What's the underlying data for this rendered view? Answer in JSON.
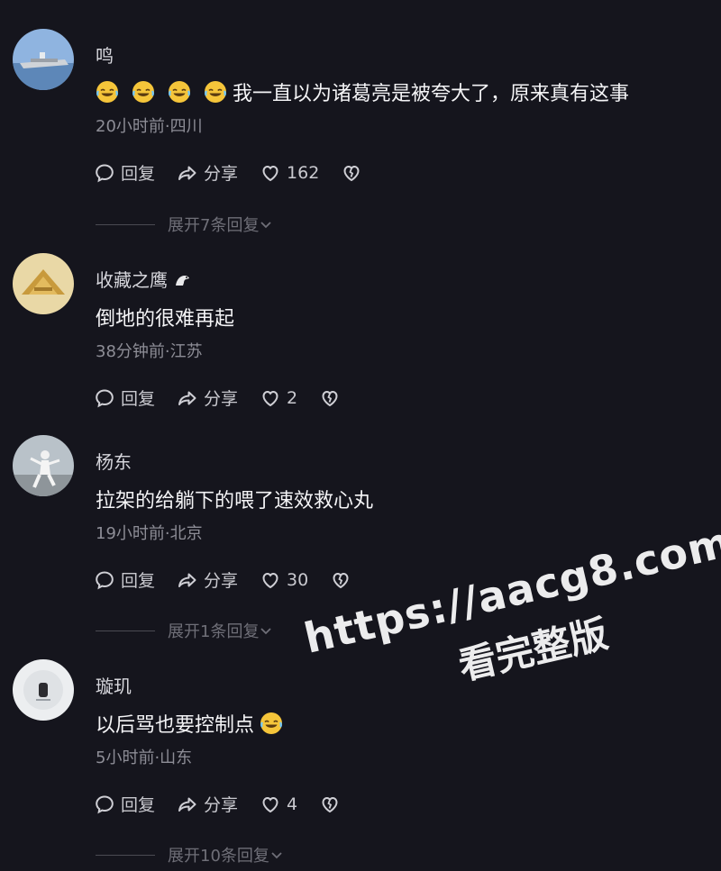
{
  "comments": [
    {
      "username": "鸣",
      "text": "我一直以为诸葛亮是被夸大了，原来真有这事",
      "meta": "20小时前·四川",
      "reply_label": "回复",
      "share_label": "分享",
      "likes": "162",
      "expand_label": "展开7条回复"
    },
    {
      "username": "收藏之鹰",
      "text": "倒地的很难再起",
      "meta": "38分钟前·江苏",
      "reply_label": "回复",
      "share_label": "分享",
      "likes": "2"
    },
    {
      "username": "杨东",
      "text": "拉架的给躺下的喂了速效救心丸",
      "meta": "19小时前·北京",
      "reply_label": "回复",
      "share_label": "分享",
      "likes": "30",
      "expand_label": "展开1条回复"
    },
    {
      "username": "璇玑",
      "text": "以后骂也要控制点",
      "meta": "5小时前·山东",
      "reply_label": "回复",
      "share_label": "分享",
      "likes": "4",
      "expand_label": "展开10条回复"
    }
  ],
  "watermark": {
    "url": "https://aacg8.com",
    "caption": "看完整版"
  },
  "icons": {
    "reply": "reply-bubble-icon",
    "share": "share-arrow-icon",
    "like": "heart-icon",
    "dislike": "broken-heart-icon",
    "emoji": "laughing-tears-emoji",
    "badge": "eagle-icon"
  },
  "colors": {
    "background": "#15151d",
    "text": "#f4f4f6",
    "meta": "#8d8d96",
    "emoji": "#f5c53a"
  }
}
